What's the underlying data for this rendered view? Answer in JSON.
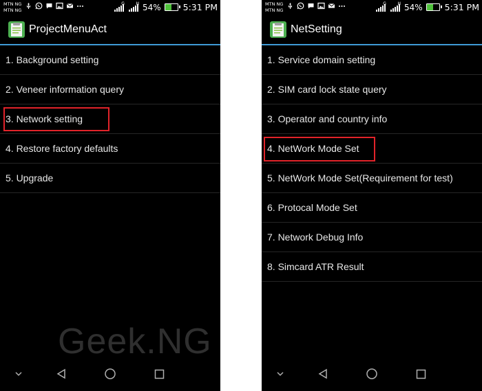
{
  "colors": {
    "accent": "#3f9ad6",
    "highlight": "#e2232a",
    "battery": "#4fc13c"
  },
  "status_bar": {
    "carrier_line_1": "MTN NG",
    "carrier_line_2": "MTN NG",
    "network_type": "G",
    "network_type_2": "H",
    "battery_percent": "54%",
    "battery_level": 0.54,
    "time": "5:31 PM"
  },
  "screens": [
    {
      "title": "ProjectMenuAct",
      "items": [
        {
          "label": "1. Background setting"
        },
        {
          "label": "2. Veneer information query"
        },
        {
          "label": "3. Network setting"
        },
        {
          "label": "4. Restore factory defaults"
        },
        {
          "label": "5. Upgrade"
        }
      ],
      "highlighted_index": 2,
      "watermark": "Geek.NG"
    },
    {
      "title": "NetSetting",
      "items": [
        {
          "label": "1. Service domain setting"
        },
        {
          "label": "2. SIM card lock state query"
        },
        {
          "label": "3. Operator and country info"
        },
        {
          "label": "4. NetWork Mode Set"
        },
        {
          "label": "5. NetWork Mode Set(Requirement for test)"
        },
        {
          "label": "6. Protocal Mode Set"
        },
        {
          "label": "7. Network Debug Info"
        },
        {
          "label": "8. Simcard ATR Result"
        }
      ],
      "highlighted_index": 3
    }
  ]
}
